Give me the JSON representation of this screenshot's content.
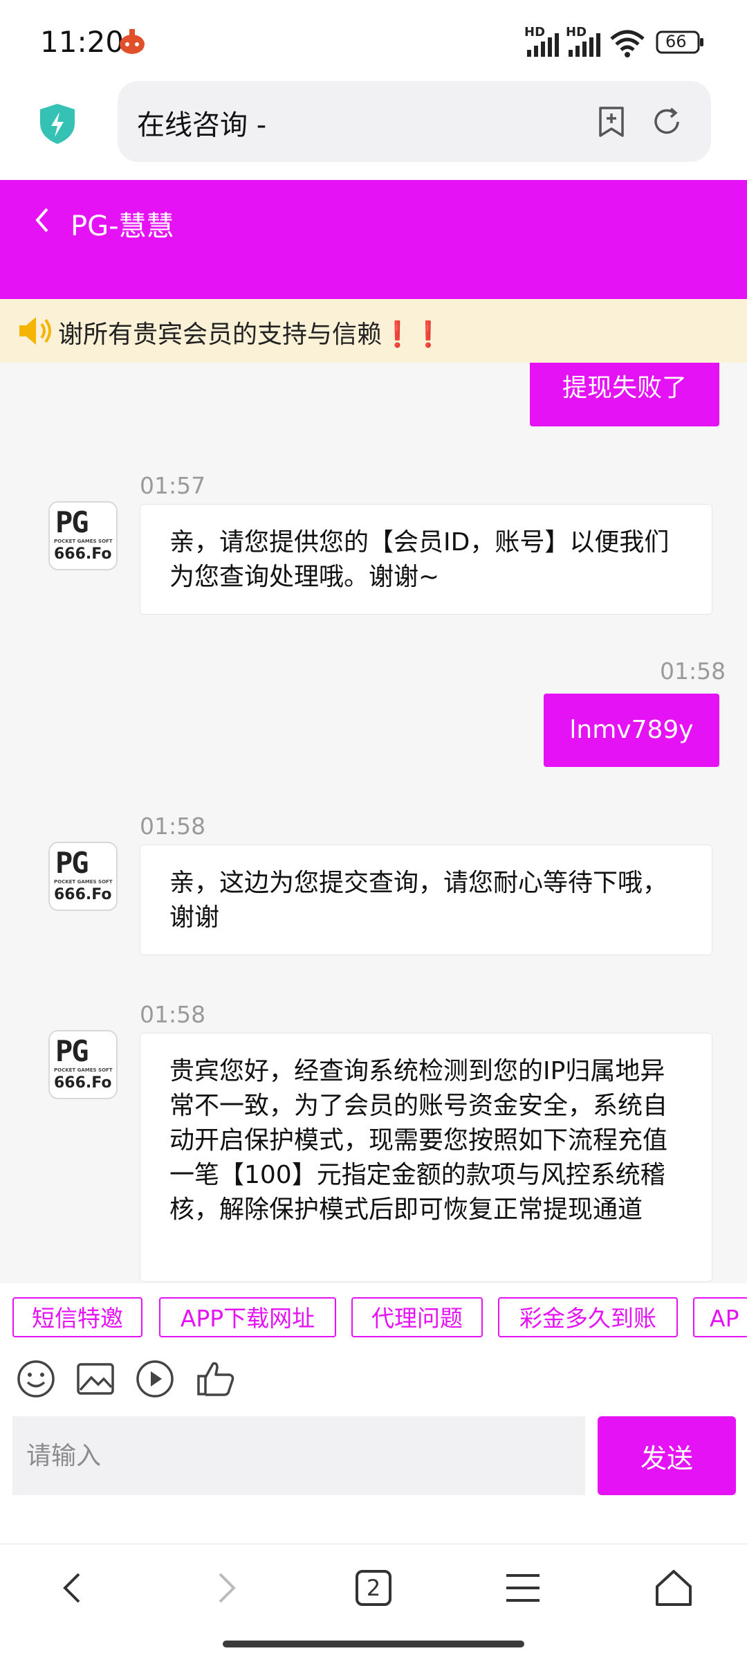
{
  "status_bar": {
    "time": "11:20",
    "battery": "66",
    "hd": "HD"
  },
  "browser": {
    "url_title": "在线咨询 -"
  },
  "chat": {
    "title": "PG-慧慧",
    "notice": "谢所有贵宾会员的支持与信赖",
    "notice_emoji": "❗❗",
    "messages": [
      {
        "from": "user",
        "text": "提现失败了"
      },
      {
        "from": "agent",
        "time": "01:57",
        "text": "亲，请您提供您的【会员ID，账号】以便我们为您查询处理哦。谢谢~"
      },
      {
        "from": "user",
        "time": "01:58",
        "text": "lnmv789y"
      },
      {
        "from": "agent",
        "time": "01:58",
        "text": "亲，这边为您提交查询，请您耐心等待下哦，谢谢"
      },
      {
        "from": "agent",
        "time": "01:58",
        "text": "贵宾您好，经查询系统检测到您的IP归属地异常不一致，为了会员的账号资金安全，系统自动开启保护模式，现需要您按照如下流程充值一笔【100】元指定金额的款项与风控系统稽核，解除保护模式后即可恢复正常提现通道"
      }
    ],
    "avatar": {
      "logo": "PG",
      "sub": "POCKET GAMES SOFT",
      "num": "666.Fo"
    }
  },
  "quick_replies": [
    "短信特邀",
    "APP下载网址",
    "代理问题",
    "彩金多久到账",
    "AP"
  ],
  "input": {
    "placeholder": "请输入",
    "send_label": "发送"
  },
  "nav": {
    "tab_count": "2"
  },
  "colors": {
    "accent": "#e512f5",
    "notice_bg": "#fbf1d6"
  }
}
